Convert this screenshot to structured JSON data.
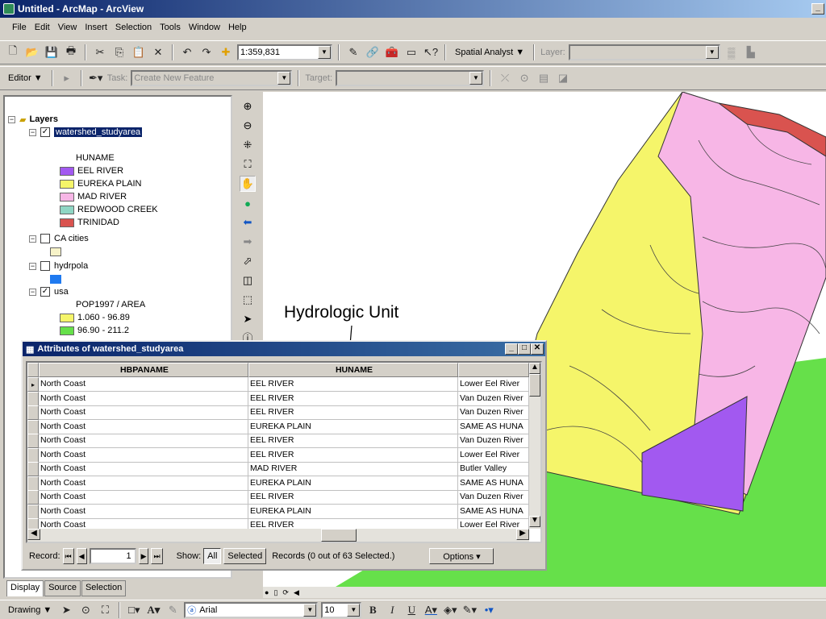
{
  "window": {
    "title": "Untitled - ArcMap - ArcView"
  },
  "menu": [
    "File",
    "Edit",
    "View",
    "Insert",
    "Selection",
    "Tools",
    "Window",
    "Help"
  ],
  "toolbar1": {
    "scale": "1:359,831",
    "spatial_analyst": "Spatial Analyst ▼",
    "layer_label": "Layer:"
  },
  "toolbar2": {
    "editor": "Editor ▼",
    "task_label": "Task:",
    "task_value": "Create New Feature",
    "target_label": "Target:"
  },
  "toc": {
    "root": "Layers",
    "layers": [
      {
        "name": "watershed_studyarea",
        "checked": true,
        "field": "HUNAME",
        "classes": [
          {
            "label": "EEL RIVER",
            "color": "#a259f0"
          },
          {
            "label": "EUREKA PLAIN",
            "color": "#f5f56a"
          },
          {
            "label": "MAD RIVER",
            "color": "#f7b6e6"
          },
          {
            "label": "REDWOOD CREEK",
            "color": "#8fd6c4"
          },
          {
            "label": "TRINIDAD",
            "color": "#d9534f"
          }
        ]
      },
      {
        "name": "CA cities",
        "checked": false,
        "swatch": "#f7f3c8"
      },
      {
        "name": "hydrpola",
        "checked": false,
        "swatch": "#1f7af0"
      },
      {
        "name": "usa",
        "checked": true,
        "field": "POP1997 / AREA",
        "classes": [
          {
            "label": "1.060 - 96.89",
            "color": "#f5f56a"
          },
          {
            "label": "96.90 - 211.2",
            "color": "#66e04a"
          }
        ]
      }
    ]
  },
  "annotation": {
    "text": "Hydrologic Unit"
  },
  "attributes": {
    "title": "Attributes of watershed_studyarea",
    "columns": [
      "HBPANAME",
      "HUNAME",
      ""
    ],
    "rows": [
      [
        "North Coast",
        "EEL RIVER",
        "Lower Eel River"
      ],
      [
        "North Coast",
        "EEL RIVER",
        "Van Duzen River"
      ],
      [
        "North Coast",
        "EEL RIVER",
        "Van Duzen River"
      ],
      [
        "North Coast",
        "EUREKA PLAIN",
        "SAME AS HUNA"
      ],
      [
        "North Coast",
        "EEL RIVER",
        "Van Duzen River"
      ],
      [
        "North Coast",
        "EEL RIVER",
        "Lower Eel River"
      ],
      [
        "North Coast",
        "MAD RIVER",
        "Butler Valley"
      ],
      [
        "North Coast",
        "EUREKA PLAIN",
        "SAME AS HUNA"
      ],
      [
        "North Coast",
        "EEL RIVER",
        "Van Duzen River"
      ],
      [
        "North Coast",
        "EUREKA PLAIN",
        "SAME AS HUNA"
      ],
      [
        "North Coast",
        "EEL RIVER",
        "Lower Eel River"
      ]
    ],
    "record_label": "Record:",
    "record_value": "1",
    "show_label": "Show:",
    "all_label": "All",
    "selected_label": "Selected",
    "records_text": "Records (0 out of 63 Selected.)",
    "options_label": "Options ▾"
  },
  "tabs": [
    "Display",
    "Source",
    "Selection"
  ],
  "drawing": {
    "drawing_label": "Drawing ▼",
    "font": "Arial",
    "size": "10"
  },
  "colors": {
    "eel": "#a259f0",
    "eureka": "#f5f56a",
    "mad": "#f7b6e6",
    "trinidad": "#d9534f",
    "land": "#66e04a"
  }
}
